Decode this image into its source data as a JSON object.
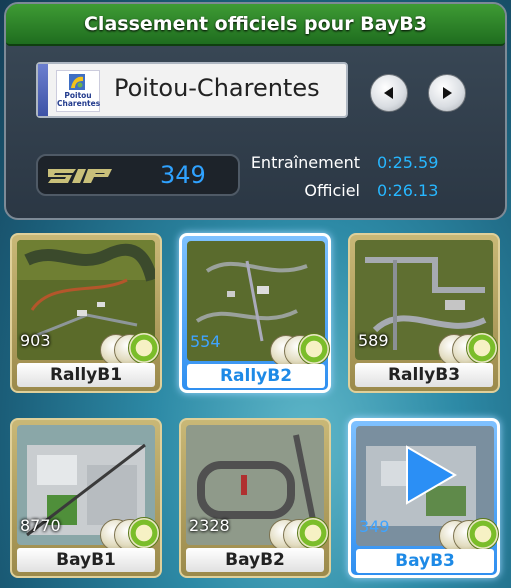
{
  "title": "Classement officiels pour BayB3",
  "region": {
    "name": "Poitou-Charentes",
    "logo_text_line1": "Poitou",
    "logo_text_line2": "Charentes"
  },
  "sp": {
    "logo_text": "SP",
    "value": "349"
  },
  "times": {
    "training_label": "Entraînement",
    "training_value": "0:25.59",
    "official_label": "Officiel",
    "official_value": "0:26.13"
  },
  "nav": {
    "prev_icon": "arrow-left-icon",
    "next_icon": "arrow-right-icon"
  },
  "tracks": [
    {
      "name": "RallyB1",
      "count": "903",
      "selected": false
    },
    {
      "name": "RallyB2",
      "count": "554",
      "selected": true
    },
    {
      "name": "RallyB3",
      "count": "589",
      "selected": false
    },
    {
      "name": "BayB1",
      "count": "8770",
      "selected": false
    },
    {
      "name": "BayB2",
      "count": "2328",
      "selected": false
    },
    {
      "name": "BayB3",
      "count": "349",
      "selected": true
    }
  ],
  "colors": {
    "title_green": "#2e8a2a",
    "accent_blue": "#27b7ff",
    "card_gold": "#c9b877",
    "card_selected": "#2f8ff0"
  }
}
